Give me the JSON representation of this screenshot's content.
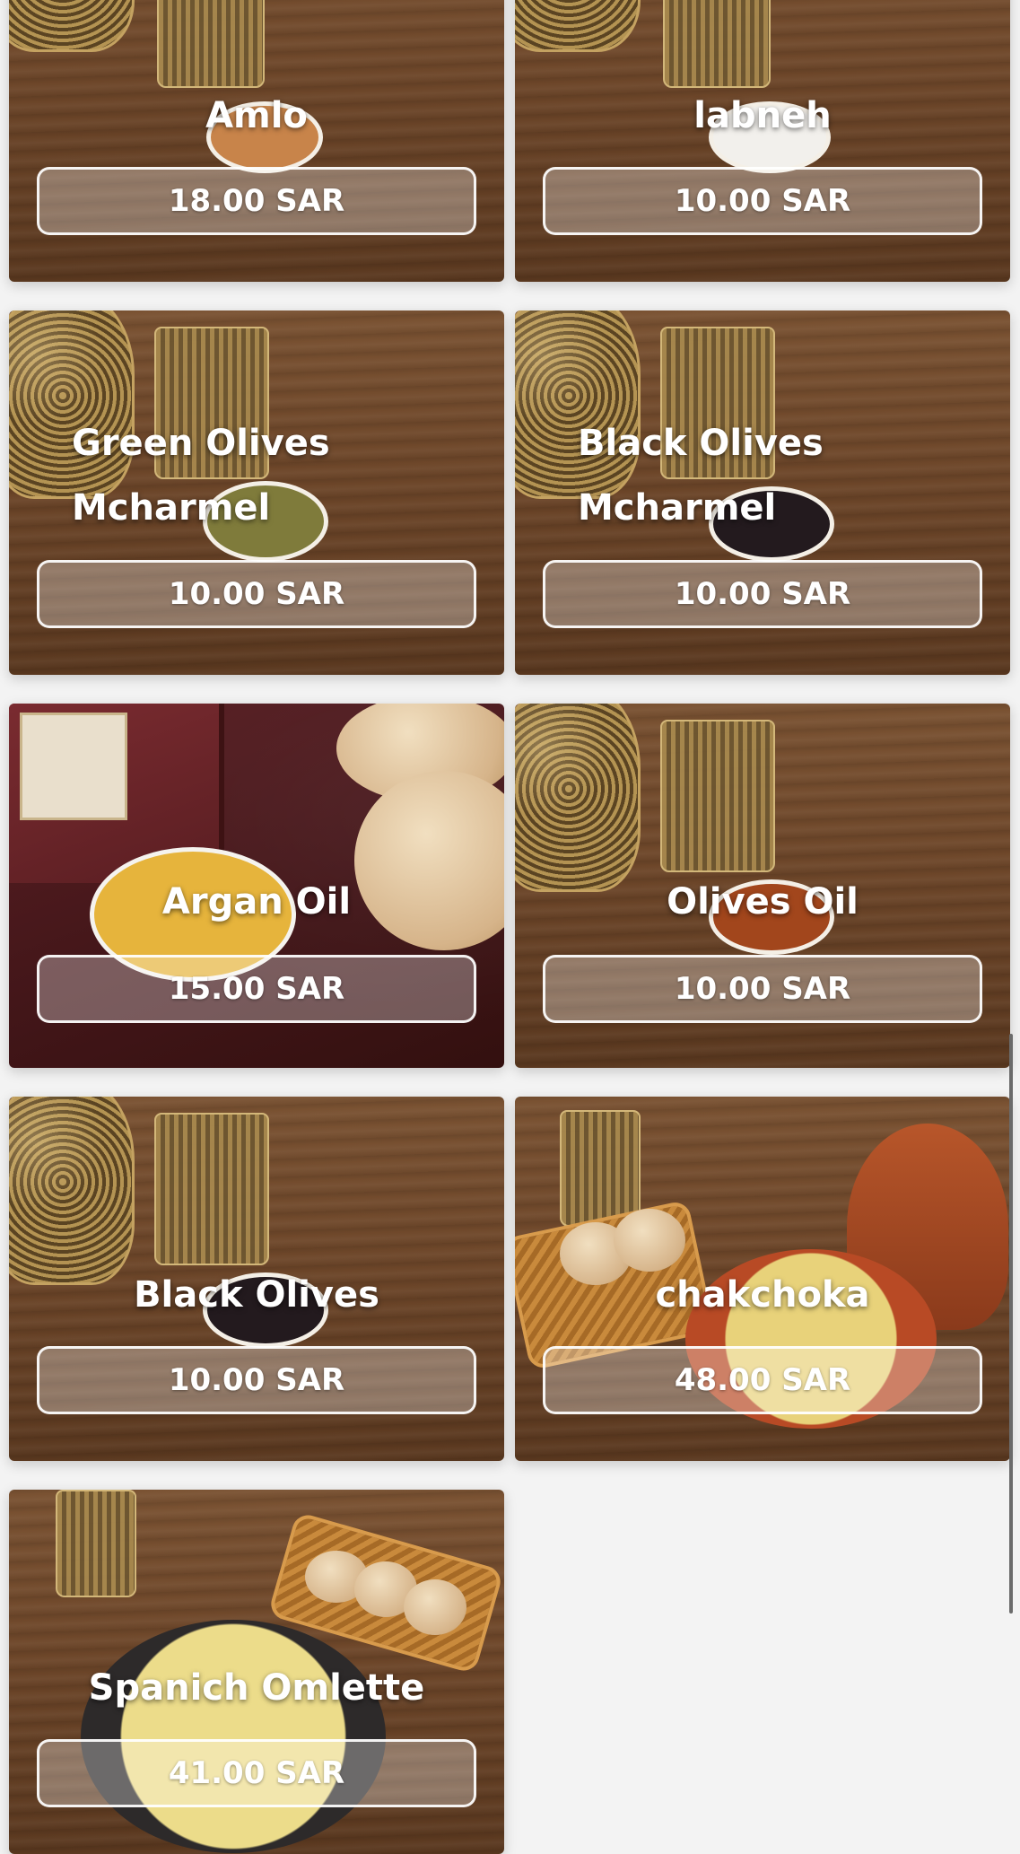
{
  "menu": {
    "items": [
      {
        "name": "Amlo",
        "price": "18.00 SAR"
      },
      {
        "name": "labneh",
        "price": "10.00 SAR"
      },
      {
        "name": "Green Olives Mcharmel",
        "price": "10.00 SAR"
      },
      {
        "name": "Black Olives Mcharmel",
        "price": "10.00 SAR"
      },
      {
        "name": "Argan Oil",
        "price": "15.00 SAR"
      },
      {
        "name": "Olives Oil",
        "price": "10.00 SAR"
      },
      {
        "name": "Black Olives",
        "price": "10.00 SAR"
      },
      {
        "name": "chakchoka",
        "price": "48.00 SAR"
      },
      {
        "name": "Spanich Omlette",
        "price": "41.00 SAR"
      }
    ]
  },
  "colors": {
    "card_wood": "#6d4629",
    "card_maroon": "#431619",
    "price_border": "#ffffff",
    "page_background": "#f3f3f3"
  }
}
